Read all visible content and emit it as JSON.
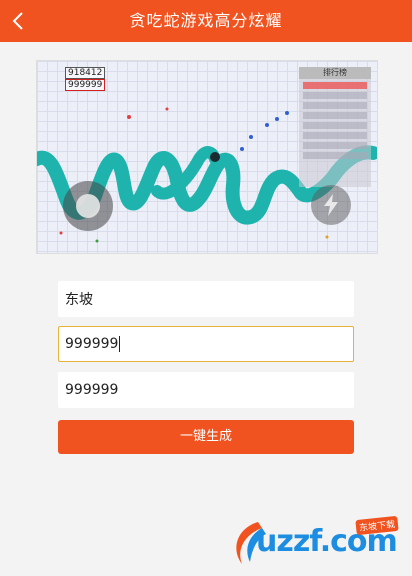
{
  "header": {
    "title": "贪吃蛇游戏高分炫耀"
  },
  "screenshot": {
    "score_top": "918412",
    "score_edit": "999999",
    "rank_title": "排行榜"
  },
  "form": {
    "name_value": "东坡",
    "score1_value": "999999",
    "score2_value": "999999"
  },
  "button": {
    "label": "一键生成"
  },
  "watermark": {
    "text": "uzzf.com",
    "tag": "东坡下载"
  },
  "colors": {
    "accent": "#f0531f",
    "snake": "#1fb3ad",
    "focus": "#e8b23c"
  }
}
